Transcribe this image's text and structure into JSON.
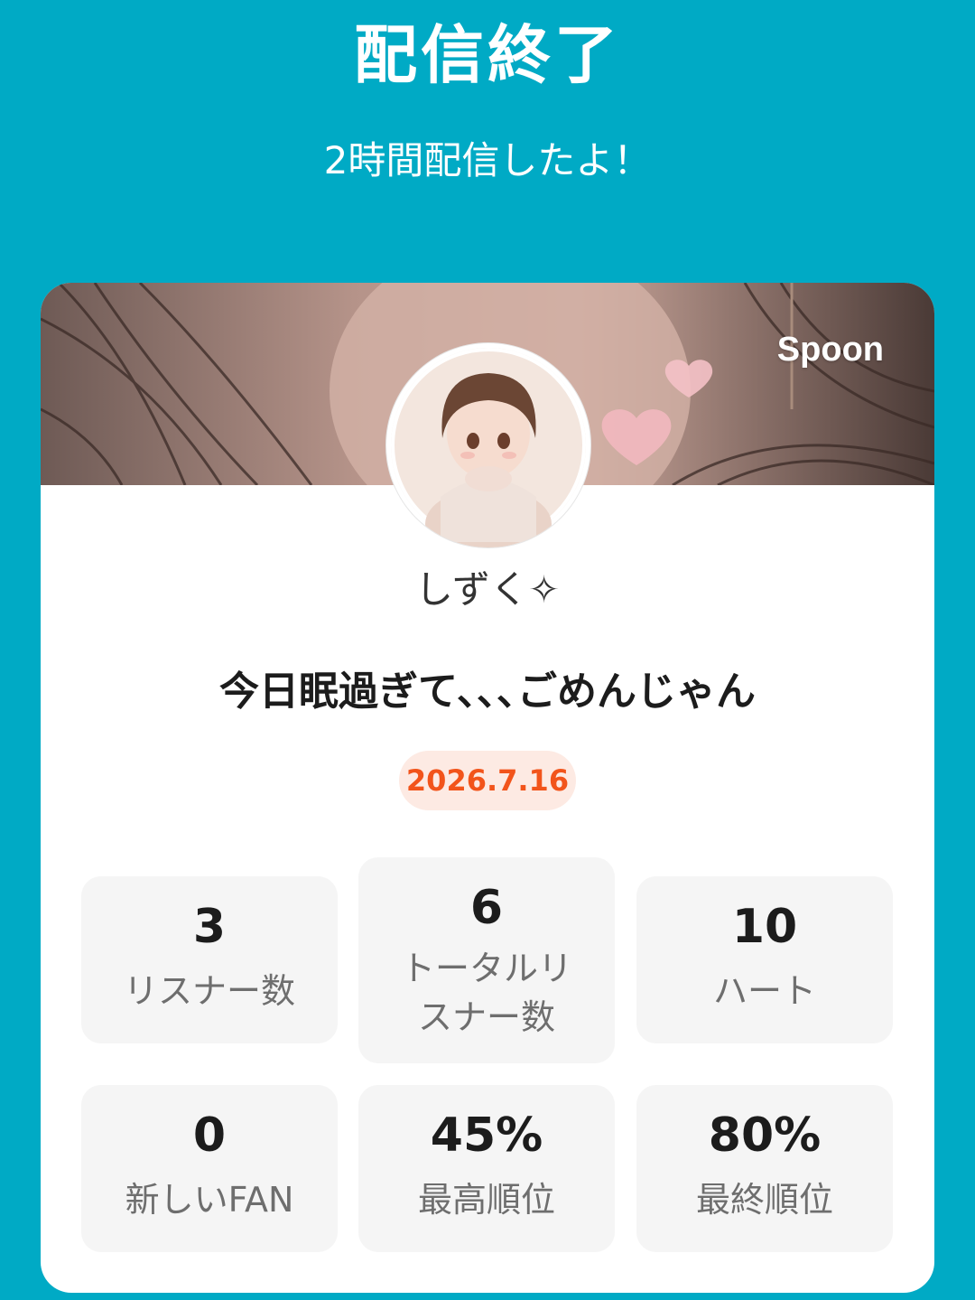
{
  "header": {
    "title": "配信終了",
    "subtitle": "2時間配信したよ！"
  },
  "card": {
    "brand": "Spoon",
    "username": "しずく✧",
    "live_title": "今日眠過ぎて､､､ごめんじゃん",
    "date": "2026.7.16",
    "stats": [
      {
        "value": "3",
        "label": "リスナー数"
      },
      {
        "value": "6",
        "label": "トータルリスナー数"
      },
      {
        "value": "10",
        "label": "ハート"
      },
      {
        "value": "0",
        "label": "新しいFAN"
      },
      {
        "value": "45%",
        "label": "最高順位"
      },
      {
        "value": "80%",
        "label": "最終順位"
      }
    ]
  },
  "colors": {
    "background": "#00aac5",
    "date_text": "#f2541b",
    "date_badge": "#fdeae3"
  },
  "icons": [
    "spoon-logo",
    "sparkle-icon"
  ]
}
